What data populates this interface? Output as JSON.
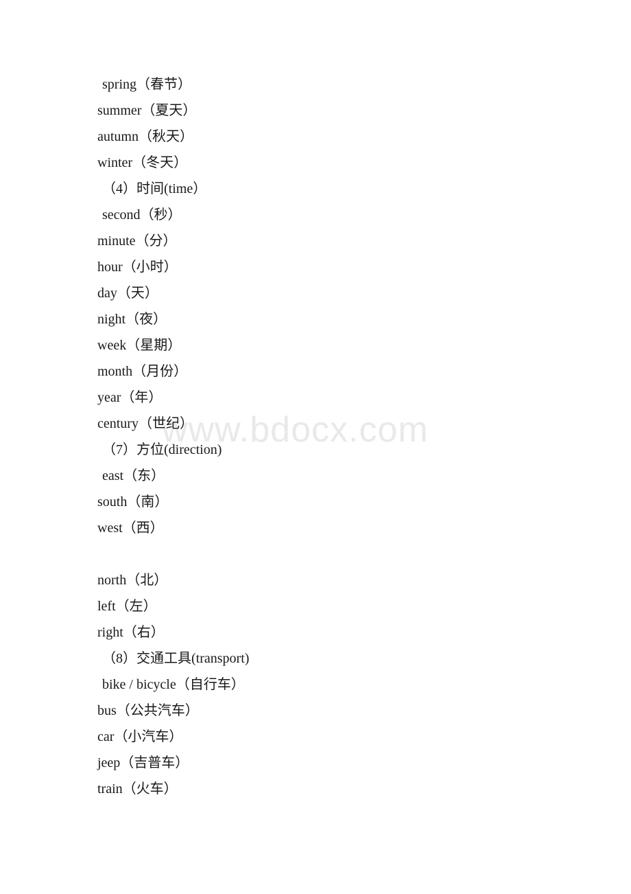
{
  "document": {
    "watermark": "www.bdocx.com",
    "watermark_color": "#e9e9e9",
    "text_color": "#1a1a1a",
    "background_color": "#ffffff",
    "lines": [
      {
        "text": "spring（春节）",
        "indent": true
      },
      {
        "text": "summer（夏天）",
        "indent": false
      },
      {
        "text": "autumn（秋天）",
        "indent": false
      },
      {
        "text": "winter（冬天）",
        "indent": false
      },
      {
        "text": "（4）时间(time）",
        "indent": true
      },
      {
        "text": "second（秒）",
        "indent": true
      },
      {
        "text": "minute（分）",
        "indent": false
      },
      {
        "text": "hour（小时）",
        "indent": false
      },
      {
        "text": "day（天）",
        "indent": false
      },
      {
        "text": "night（夜）",
        "indent": false
      },
      {
        "text": "week（星期）",
        "indent": false
      },
      {
        "text": "month（月份）",
        "indent": false
      },
      {
        "text": "year（年）",
        "indent": false
      },
      {
        "text": "century（世纪）",
        "indent": false
      },
      {
        "text": "（7）方位(direction)",
        "indent": true
      },
      {
        "text": "east（东）",
        "indent": true
      },
      {
        "text": "south（南）",
        "indent": false
      },
      {
        "text": "west（西）",
        "indent": false
      },
      {
        "text": "",
        "indent": false
      },
      {
        "text": "north（北）",
        "indent": false
      },
      {
        "text": "left（左）",
        "indent": false
      },
      {
        "text": "right（右）",
        "indent": false
      },
      {
        "text": "（8）交通工具(transport)",
        "indent": true
      },
      {
        "text": "bike / bicycle（自行车）",
        "indent": true
      },
      {
        "text": "bus（公共汽车）",
        "indent": false
      },
      {
        "text": "car（小汽车）",
        "indent": false
      },
      {
        "text": "jeep（吉普车）",
        "indent": false
      },
      {
        "text": "train（火车）",
        "indent": false
      }
    ]
  }
}
